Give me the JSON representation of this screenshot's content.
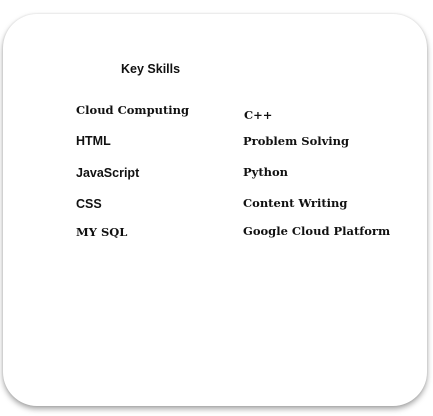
{
  "card": {
    "title": "Key Skills",
    "skills_left": [
      "Cloud Computing",
      "HTML",
      "JavaScript",
      "CSS",
      "MY SQL"
    ],
    "skills_right": [
      "C++",
      "Problem Solving",
      "Python",
      "Content Writing",
      "Google Cloud Platform"
    ]
  }
}
